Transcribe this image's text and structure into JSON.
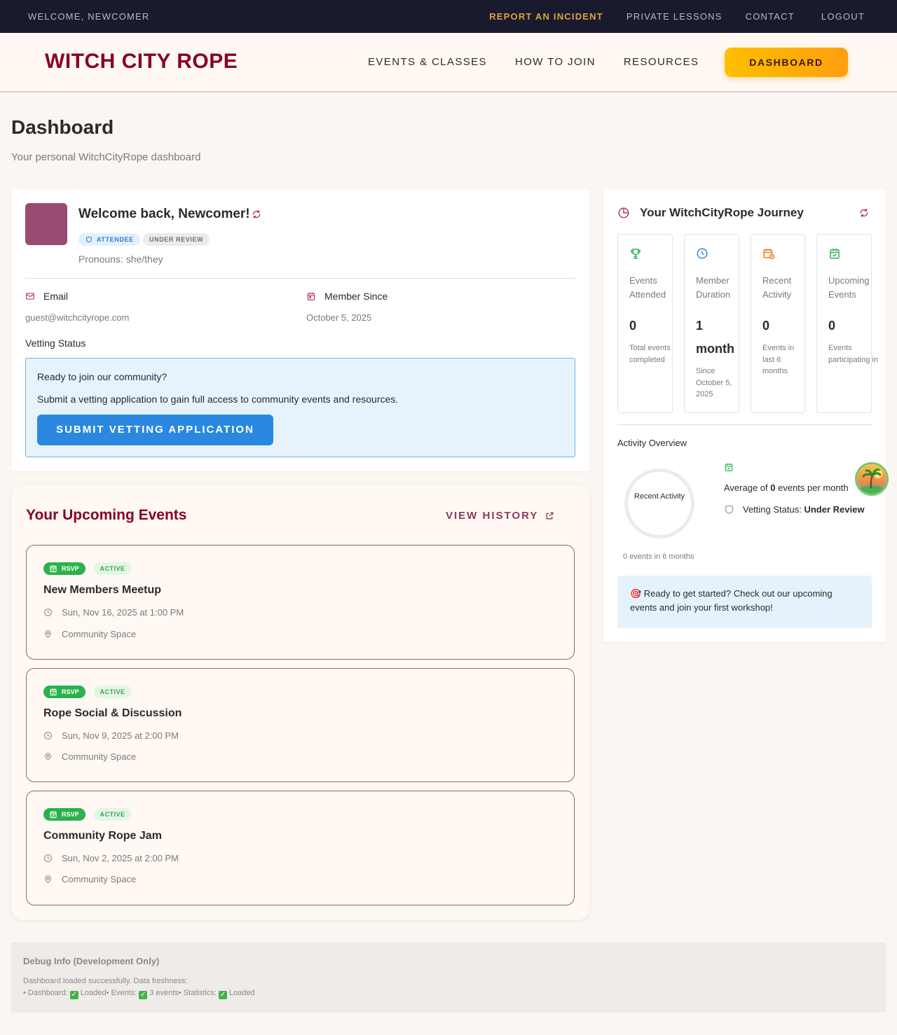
{
  "utility_bar": {
    "welcome": "WELCOME, NEWCOMER",
    "links": [
      "REPORT AN INCIDENT",
      "PRIVATE LESSONS",
      "CONTACT",
      "LOGOUT"
    ]
  },
  "header": {
    "brand": "WITCH CITY ROPE",
    "nav": [
      "EVENTS & CLASSES",
      "HOW TO JOIN",
      "RESOURCES"
    ],
    "dashboard_button": "DASHBOARD"
  },
  "page": {
    "title": "Dashboard",
    "subtitle": "Your personal WitchCityRope dashboard"
  },
  "profile": {
    "welcome": "Welcome back, Newcomer!",
    "badges": [
      "ATTENDEE",
      "UNDER REVIEW"
    ],
    "pronouns": "Pronouns: she/they",
    "email_label": "Email",
    "email_value": "guest@witchcityrope.com",
    "member_since_label": "Member Since",
    "member_since_value": "October 5, 2025",
    "vetting_label": "Vetting Status",
    "vetting_question": "Ready to join our community?",
    "vetting_description": "Submit a vetting application to gain full access to community events and resources.",
    "vetting_button": "SUBMIT VETTING APPLICATION"
  },
  "upcoming": {
    "title": "Your Upcoming Events",
    "view_history": "VIEW HISTORY",
    "events": [
      {
        "rsvp": "RSVP",
        "status": "ACTIVE",
        "title": "New Members Meetup",
        "datetime": "Sun, Nov 16, 2025 at 1:00 PM",
        "location": "Community Space"
      },
      {
        "rsvp": "RSVP",
        "status": "ACTIVE",
        "title": "Rope Social & Discussion",
        "datetime": "Sun, Nov 9, 2025 at 2:00 PM",
        "location": "Community Space"
      },
      {
        "rsvp": "RSVP",
        "status": "ACTIVE",
        "title": "Community Rope Jam",
        "datetime": "Sun, Nov 2, 2025 at 2:00 PM",
        "location": "Community Space"
      }
    ]
  },
  "journey": {
    "title": "Your WitchCityRope Journey",
    "stats": [
      {
        "icon": "trophy-icon",
        "color": "#2bb24c",
        "label": "Events Attended",
        "value": "0",
        "sub": "Total events completed"
      },
      {
        "icon": "clock-icon",
        "color": "#2b88e0",
        "label": "Member Duration",
        "value": "1 month",
        "sub": "Since October 5, 2025"
      },
      {
        "icon": "calendar-clock-icon",
        "color": "#f07a1a",
        "label": "Recent Activity",
        "value": "0",
        "sub": "Events in last 6 months"
      },
      {
        "icon": "calendar-check-icon",
        "color": "#2bb24c",
        "label": "Upcoming Events",
        "value": "0",
        "sub": "Events participating in"
      }
    ],
    "activity_title": "Activity Overview",
    "ring_label": "Recent Activity",
    "ring_caption": "0 events in 6 months",
    "avg_prefix": "Average of ",
    "avg_value": "0",
    "avg_suffix": " events per month",
    "vetting_prefix": "Vetting Status: ",
    "vetting_value": "Under Review",
    "tip": "🎯 Ready to get started? Check out our upcoming events and join your first workshop!"
  },
  "debug": {
    "title": "Debug Info (Development Only)",
    "line1": "Dashboard loaded successfully. Data freshness:",
    "dashboard_prefix": "• Dashboard: ",
    "dashboard_status": "Loaded",
    "events_prefix": "• Events: ",
    "events_status": "3 events",
    "stats_prefix": "• Statistics: ",
    "stats_status": "Loaded"
  },
  "colors": {
    "brand": "#880124",
    "accent_gold": "#ffbf00",
    "primary_blue": "#2b88e0",
    "success_green": "#2bb24c"
  }
}
